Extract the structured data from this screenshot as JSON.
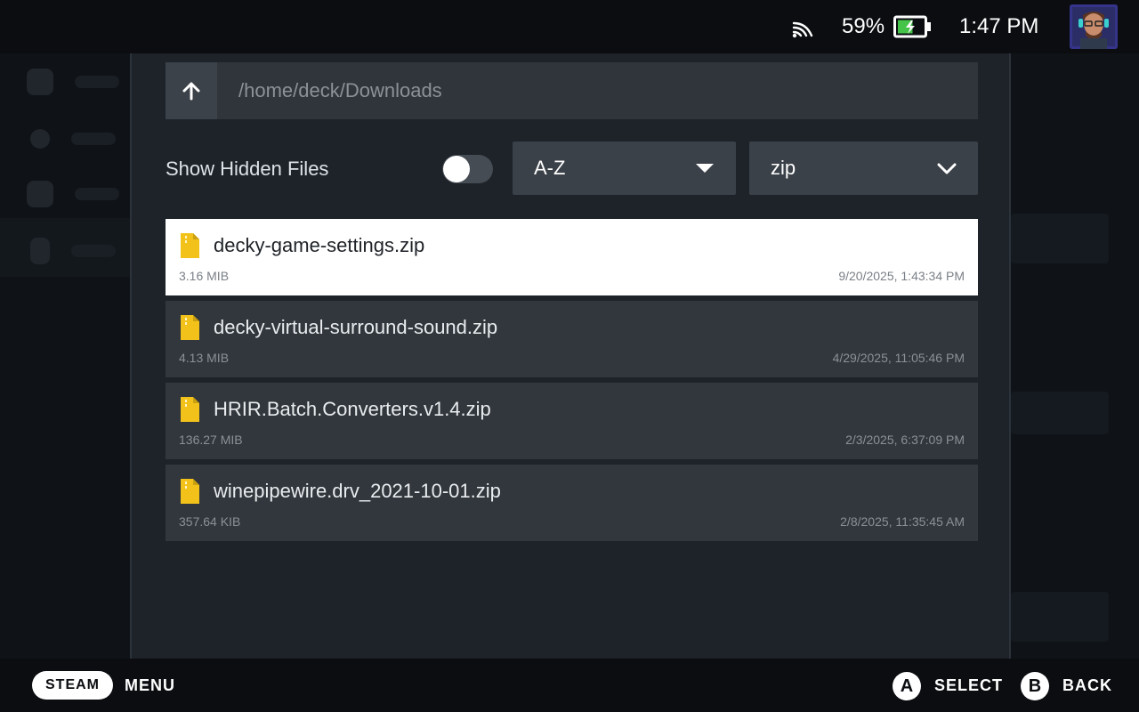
{
  "status_bar": {
    "battery_percent": "59%",
    "battery_level": 0.59,
    "time": "1:47 PM",
    "icons": [
      "wifi-icon",
      "battery-charging-icon",
      "user-avatar"
    ]
  },
  "file_picker": {
    "path": "/home/deck/Downloads",
    "up_icon": "arrow-up-icon",
    "show_hidden_label": "Show Hidden Files",
    "show_hidden_enabled": false,
    "sort": {
      "selected": "A-Z",
      "icon": "caret-down-icon"
    },
    "filter": {
      "selected": "zip",
      "icon": "chevron-down-icon"
    },
    "files": [
      {
        "name": "decky-game-settings.zip",
        "size": "3.16 MIB",
        "modified": "9/20/2025, 1:43:34 PM",
        "selected": true
      },
      {
        "name": "decky-virtual-surround-sound.zip",
        "size": "4.13 MIB",
        "modified": "4/29/2025, 11:05:46 PM",
        "selected": false
      },
      {
        "name": "HRIR.Batch.Converters.v1.4.zip",
        "size": "136.27 MIB",
        "modified": "2/3/2025, 6:37:09 PM",
        "selected": false
      },
      {
        "name": "winepipewire.drv_2021-10-01.zip",
        "size": "357.64 KIB",
        "modified": "2/8/2025, 11:35:45 AM",
        "selected": false
      }
    ],
    "file_icon": "zip-file-icon"
  },
  "footer": {
    "steam_label": "STEAM",
    "menu_label": "MENU",
    "a_glyph": "A",
    "select_label": "SELECT",
    "b_glyph": "B",
    "back_label": "BACK"
  },
  "colors": {
    "background": "#0b0d10",
    "dialog": "#1d2329",
    "row": "#32373d",
    "row_selected": "#ffffff",
    "file_icon": "#f2c21b"
  }
}
